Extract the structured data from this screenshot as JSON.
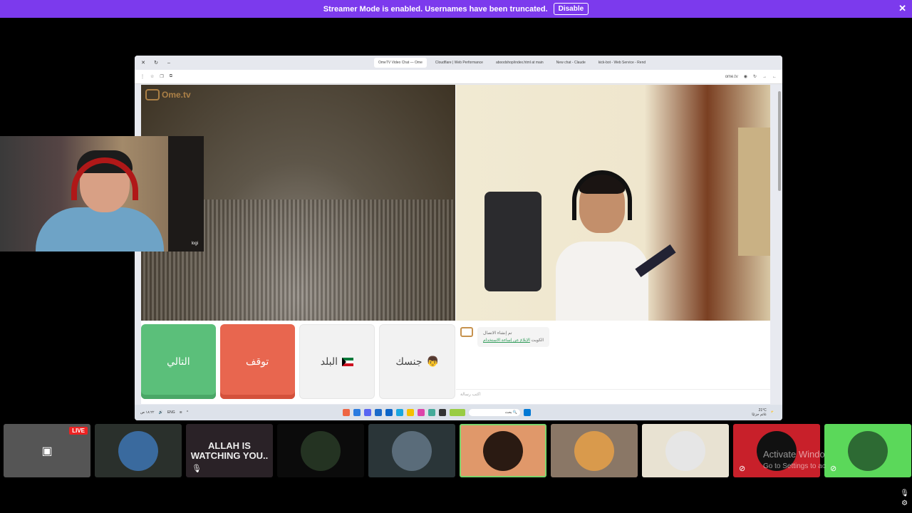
{
  "banner": {
    "message": "Streamer Mode is enabled. Usernames have been truncated.",
    "disable_label": "Disable",
    "close_icon": "close-icon",
    "color": "#7c3aed"
  },
  "browser": {
    "tabs": [
      {
        "label": "OmeTV Video Chat — Ome",
        "active": true
      },
      {
        "label": "Cloudflare | Web Performance",
        "active": false
      },
      {
        "label": "aboodshop/index.html at main",
        "active": false
      },
      {
        "label": "New chat - Claude",
        "active": false
      },
      {
        "label": "kick-bot - Web Service - Rend",
        "active": false
      }
    ],
    "address_right": "ome.tv"
  },
  "ometv": {
    "logo": "Ome.tv",
    "buttons": {
      "next": "التالي",
      "stop": "توقف",
      "country": "البلد",
      "gender": "جنسك"
    },
    "chat": {
      "system_line1": "تم إنشاء الاتصال",
      "system_line2_prefix": "الكويت",
      "system_link": "الإبلاغ عن إساءة الاستخدام",
      "input_placeholder": "اكتب رسالة"
    }
  },
  "taskbar": {
    "left_text1": "١٨:٢٢ ص",
    "left_text2": "ENG",
    "search_label": "بحث",
    "weather_temp": "21°C",
    "weather_desc": "غائم جزئيًا"
  },
  "webcam": {
    "label": "logi"
  },
  "tiles": {
    "live_label": "LIVE",
    "allah_text": "ALLAH IS WATCHING YOU.."
  },
  "watermark": {
    "line1": "Activate Windo",
    "line2": "Go to Settings to ac"
  }
}
